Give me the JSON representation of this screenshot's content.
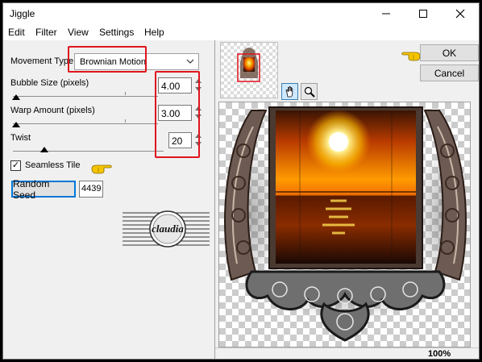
{
  "window": {
    "title": "Jiggle"
  },
  "menu": [
    "Edit",
    "Filter",
    "View",
    "Settings",
    "Help"
  ],
  "controls": {
    "movement_type_label": "Movement Type:",
    "movement_type_value": "Brownian Motion",
    "bubble_size_label": "Bubble Size (pixels)",
    "bubble_size_value": "4.00",
    "warp_amount_label": "Warp Amount (pixels)",
    "warp_amount_value": "3.00",
    "twist_label": "Twist",
    "twist_value": "20",
    "seamless_tile_label": "Seamless Tile",
    "seamless_tile_checked": true,
    "random_seed_button": "Random Seed",
    "random_seed_value": "4439"
  },
  "buttons": {
    "ok": "OK",
    "cancel": "Cancel"
  },
  "watermark": {
    "text": "claudia"
  },
  "status": {
    "zoom": "100%"
  },
  "colors": {
    "highlight": "#e0141e",
    "focus": "#0078d7",
    "pointer_hand": "#f5c400"
  },
  "icons": [
    "minimize-icon",
    "maximize-icon",
    "close-icon",
    "chevron-down-icon",
    "hand-tool-icon",
    "zoom-tool-icon",
    "pointing-hand-icon"
  ]
}
